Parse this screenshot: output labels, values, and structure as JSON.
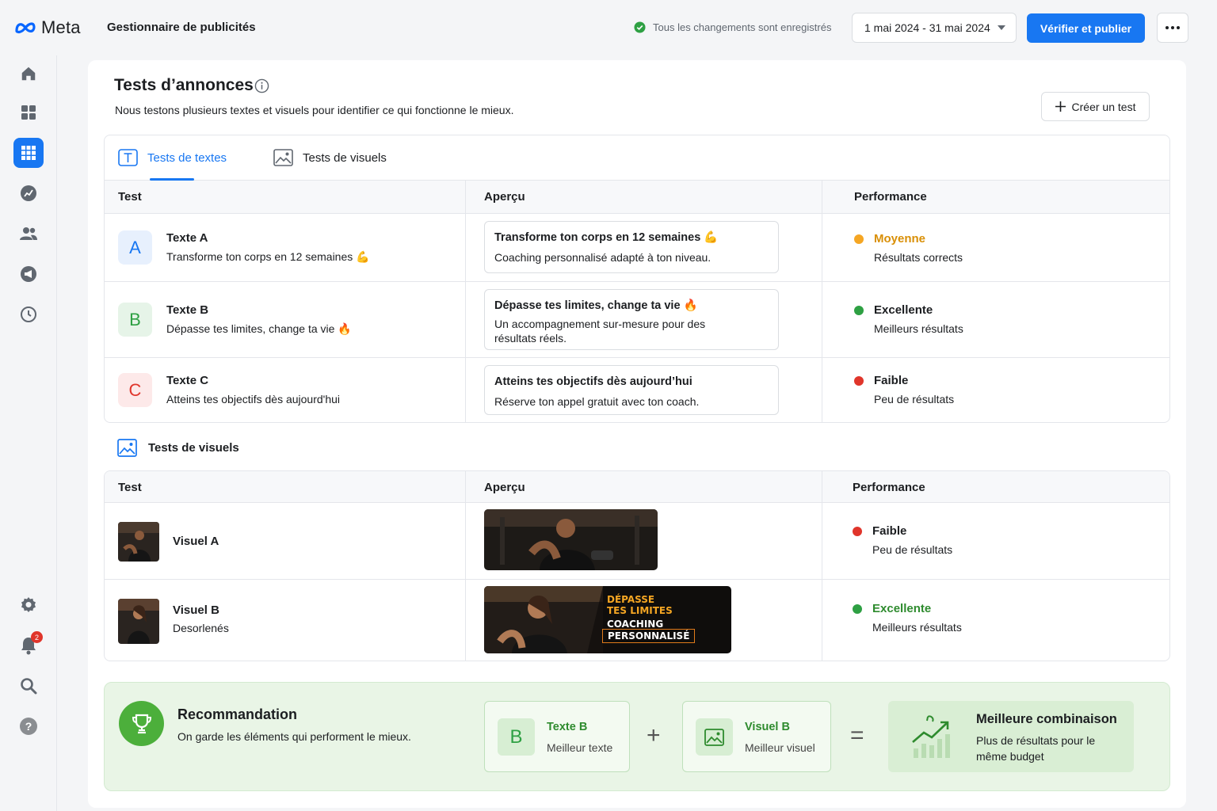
{
  "header": {
    "brand": "Meta",
    "app_title": "Gestionnaire de publicités",
    "saved_status": "Tous les changements sont enregistrés",
    "date_range": "1 mai 2024 - 31 mai 2024",
    "publish_label": "Vérifier et publier",
    "more_icon": "more-horizontal-icon"
  },
  "sidebar": {
    "items": [
      {
        "icon": "home-icon"
      },
      {
        "icon": "grid-icon"
      },
      {
        "icon": "apps-icon",
        "active": true
      },
      {
        "icon": "analytics-icon"
      },
      {
        "icon": "audience-icon"
      },
      {
        "icon": "campaign-icon"
      },
      {
        "icon": "history-icon"
      }
    ],
    "bottom": [
      {
        "icon": "settings-icon"
      },
      {
        "icon": "notifications-icon",
        "badge": "2"
      },
      {
        "icon": "search-icon"
      },
      {
        "icon": "help-icon"
      }
    ]
  },
  "page": {
    "title": "Tests d’annonces",
    "subtitle": "Nous testons plusieurs textes et visuels pour identifier ce qui fonctionne le mieux.",
    "create_label": "Créer un test"
  },
  "tabs": [
    {
      "label": "Tests de textes",
      "active": true
    },
    {
      "label": "Tests de visuels",
      "active": false
    }
  ],
  "text_table": {
    "headers": [
      "Test",
      "Aperçu",
      "Performance"
    ],
    "rows": [
      {
        "letter": "A",
        "title": "Texte A",
        "subtitle": "Transforme ton corps en 12 semaines 💪",
        "preview_title": "Transforme ton corps en 12 semaines 💪",
        "preview_desc": "Coaching personnalisé adapté à ton niveau.",
        "perf_label": "Moyenne",
        "perf_desc": "Résultats corrects",
        "perf_color": "#f5a623"
      },
      {
        "letter": "B",
        "title": "Texte B",
        "subtitle": "Dépasse tes limites, change ta vie 🔥",
        "preview_title": "Dépasse tes limites, change ta vie 🔥",
        "preview_desc": "Un accompagnement sur-mesure pour des résultats réels.",
        "perf_label": "Excellente",
        "perf_desc": "Meilleurs résultats",
        "perf_color": "#2ea043"
      },
      {
        "letter": "C",
        "title": "Texte C",
        "subtitle": "Atteins tes objectifs dès aujourd'hui",
        "preview_title": "Atteins tes objectifs dès aujourd’hui",
        "preview_desc": "Réserve ton appel gratuit avec ton coach.",
        "perf_label": "Faible",
        "perf_desc": "Peu de résultats",
        "perf_color": "#e0352b"
      }
    ]
  },
  "visual_section": {
    "title": "Tests de visuels",
    "headers": [
      "Test",
      "Aperçu",
      "Performance"
    ],
    "rows": [
      {
        "title": "Visuel A",
        "subtitle": "",
        "perf_label": "Faible",
        "perf_desc": "Peu de résultats",
        "perf_color": "#e0352b"
      },
      {
        "title": "Visuel B",
        "subtitle": "Desorlenés",
        "perf_label": "Excellente",
        "perf_desc": "Meilleurs résultats",
        "perf_color": "#2ea043",
        "banner_lines": [
          "DÉPASSE",
          "TES LIMITES",
          "COACHING",
          "PERSONNALISÉ"
        ]
      }
    ]
  },
  "recommendation": {
    "title": "Recommandation",
    "subtitle": "On garde les éléments qui performent le mieux.",
    "text_pick": {
      "letter": "B",
      "title": "Texte B",
      "subtitle": "Meilleur texte"
    },
    "visual_pick": {
      "title": "Visuel B",
      "subtitle": "Meilleur visuel"
    },
    "plus": "+",
    "equals": "=",
    "best_title": "Meilleure combinaison",
    "best_desc": "Plus de résultats pour le même budget"
  }
}
